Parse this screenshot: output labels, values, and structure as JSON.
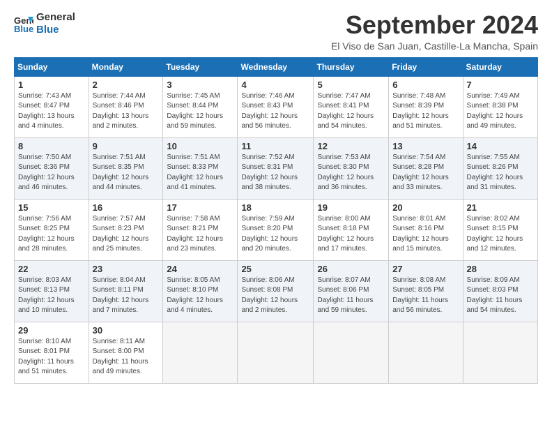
{
  "header": {
    "logo_line1": "General",
    "logo_line2": "Blue",
    "title": "September 2024",
    "location": "El Viso de San Juan, Castille-La Mancha, Spain"
  },
  "days_of_week": [
    "Sunday",
    "Monday",
    "Tuesday",
    "Wednesday",
    "Thursday",
    "Friday",
    "Saturday"
  ],
  "weeks": [
    [
      {
        "day": 1,
        "info": "Sunrise: 7:43 AM\nSunset: 8:47 PM\nDaylight: 13 hours\nand 4 minutes."
      },
      {
        "day": 2,
        "info": "Sunrise: 7:44 AM\nSunset: 8:46 PM\nDaylight: 13 hours\nand 2 minutes."
      },
      {
        "day": 3,
        "info": "Sunrise: 7:45 AM\nSunset: 8:44 PM\nDaylight: 12 hours\nand 59 minutes."
      },
      {
        "day": 4,
        "info": "Sunrise: 7:46 AM\nSunset: 8:43 PM\nDaylight: 12 hours\nand 56 minutes."
      },
      {
        "day": 5,
        "info": "Sunrise: 7:47 AM\nSunset: 8:41 PM\nDaylight: 12 hours\nand 54 minutes."
      },
      {
        "day": 6,
        "info": "Sunrise: 7:48 AM\nSunset: 8:39 PM\nDaylight: 12 hours\nand 51 minutes."
      },
      {
        "day": 7,
        "info": "Sunrise: 7:49 AM\nSunset: 8:38 PM\nDaylight: 12 hours\nand 49 minutes."
      }
    ],
    [
      {
        "day": 8,
        "info": "Sunrise: 7:50 AM\nSunset: 8:36 PM\nDaylight: 12 hours\nand 46 minutes."
      },
      {
        "day": 9,
        "info": "Sunrise: 7:51 AM\nSunset: 8:35 PM\nDaylight: 12 hours\nand 44 minutes."
      },
      {
        "day": 10,
        "info": "Sunrise: 7:51 AM\nSunset: 8:33 PM\nDaylight: 12 hours\nand 41 minutes."
      },
      {
        "day": 11,
        "info": "Sunrise: 7:52 AM\nSunset: 8:31 PM\nDaylight: 12 hours\nand 38 minutes."
      },
      {
        "day": 12,
        "info": "Sunrise: 7:53 AM\nSunset: 8:30 PM\nDaylight: 12 hours\nand 36 minutes."
      },
      {
        "day": 13,
        "info": "Sunrise: 7:54 AM\nSunset: 8:28 PM\nDaylight: 12 hours\nand 33 minutes."
      },
      {
        "day": 14,
        "info": "Sunrise: 7:55 AM\nSunset: 8:26 PM\nDaylight: 12 hours\nand 31 minutes."
      }
    ],
    [
      {
        "day": 15,
        "info": "Sunrise: 7:56 AM\nSunset: 8:25 PM\nDaylight: 12 hours\nand 28 minutes."
      },
      {
        "day": 16,
        "info": "Sunrise: 7:57 AM\nSunset: 8:23 PM\nDaylight: 12 hours\nand 25 minutes."
      },
      {
        "day": 17,
        "info": "Sunrise: 7:58 AM\nSunset: 8:21 PM\nDaylight: 12 hours\nand 23 minutes."
      },
      {
        "day": 18,
        "info": "Sunrise: 7:59 AM\nSunset: 8:20 PM\nDaylight: 12 hours\nand 20 minutes."
      },
      {
        "day": 19,
        "info": "Sunrise: 8:00 AM\nSunset: 8:18 PM\nDaylight: 12 hours\nand 17 minutes."
      },
      {
        "day": 20,
        "info": "Sunrise: 8:01 AM\nSunset: 8:16 PM\nDaylight: 12 hours\nand 15 minutes."
      },
      {
        "day": 21,
        "info": "Sunrise: 8:02 AM\nSunset: 8:15 PM\nDaylight: 12 hours\nand 12 minutes."
      }
    ],
    [
      {
        "day": 22,
        "info": "Sunrise: 8:03 AM\nSunset: 8:13 PM\nDaylight: 12 hours\nand 10 minutes."
      },
      {
        "day": 23,
        "info": "Sunrise: 8:04 AM\nSunset: 8:11 PM\nDaylight: 12 hours\nand 7 minutes."
      },
      {
        "day": 24,
        "info": "Sunrise: 8:05 AM\nSunset: 8:10 PM\nDaylight: 12 hours\nand 4 minutes."
      },
      {
        "day": 25,
        "info": "Sunrise: 8:06 AM\nSunset: 8:08 PM\nDaylight: 12 hours\nand 2 minutes."
      },
      {
        "day": 26,
        "info": "Sunrise: 8:07 AM\nSunset: 8:06 PM\nDaylight: 11 hours\nand 59 minutes."
      },
      {
        "day": 27,
        "info": "Sunrise: 8:08 AM\nSunset: 8:05 PM\nDaylight: 11 hours\nand 56 minutes."
      },
      {
        "day": 28,
        "info": "Sunrise: 8:09 AM\nSunset: 8:03 PM\nDaylight: 11 hours\nand 54 minutes."
      }
    ],
    [
      {
        "day": 29,
        "info": "Sunrise: 8:10 AM\nSunset: 8:01 PM\nDaylight: 11 hours\nand 51 minutes."
      },
      {
        "day": 30,
        "info": "Sunrise: 8:11 AM\nSunset: 8:00 PM\nDaylight: 11 hours\nand 49 minutes."
      },
      null,
      null,
      null,
      null,
      null
    ]
  ]
}
